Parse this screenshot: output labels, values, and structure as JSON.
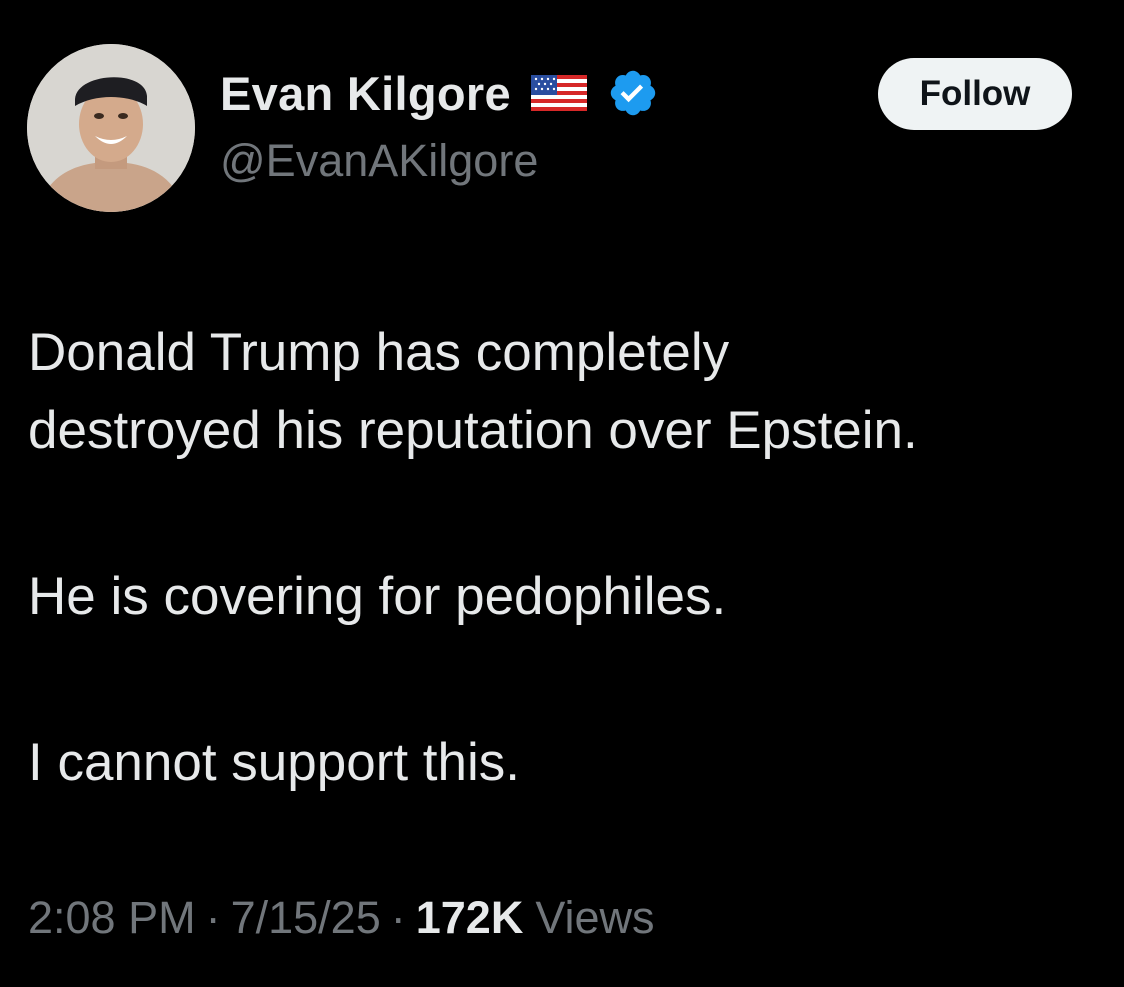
{
  "tweet": {
    "author": {
      "display_name": "Evan Kilgore",
      "handle": "@EvanAKilgore",
      "avatar_icon": "profile-photo",
      "flag_icon": "us-flag-icon",
      "verified_icon": "verified-badge-icon",
      "verified_color": "#1d9bf0"
    },
    "follow_label": "Follow",
    "text": {
      "line1": "Donald Trump has completely",
      "line2": "destroyed his reputation over Epstein.",
      "line3": "He is covering for pedophiles.",
      "line4": "I cannot support this."
    },
    "meta": {
      "time": "2:08 PM",
      "date": "7/15/25",
      "separator": "·",
      "views_count": "172K",
      "views_label": "Views"
    }
  },
  "colors": {
    "background": "#000000",
    "primary_text": "#e7e9ea",
    "secondary_text": "#71767b",
    "follow_button_bg": "#eff3f4",
    "follow_button_text": "#0f1419"
  }
}
